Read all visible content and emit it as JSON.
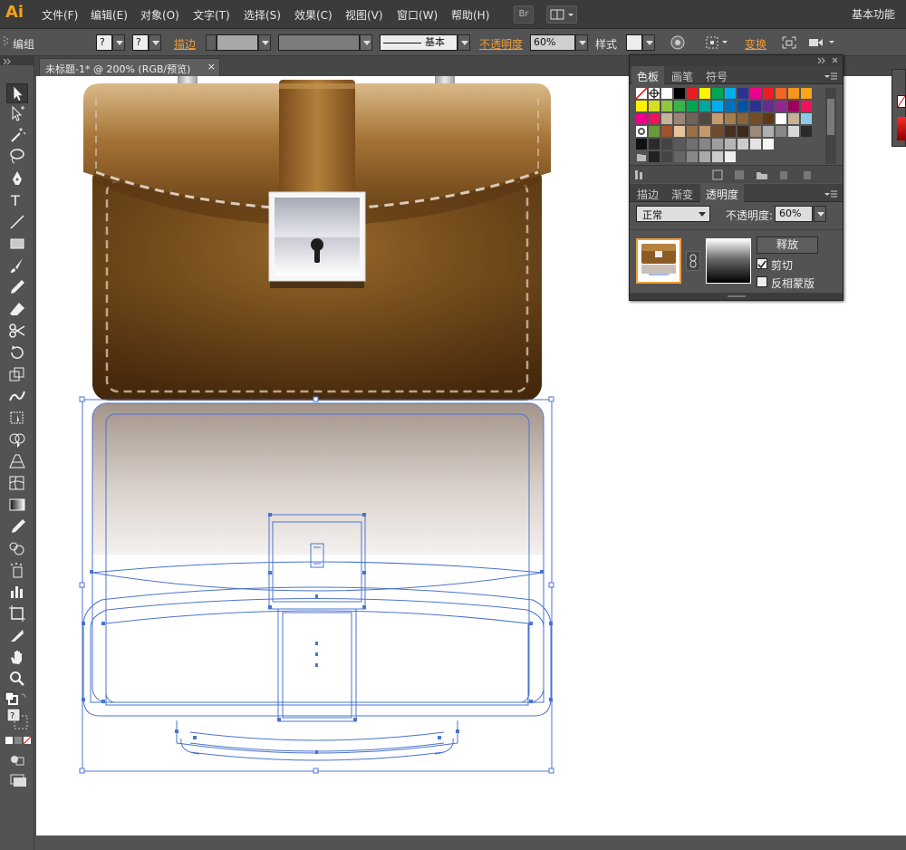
{
  "app": {
    "logo": "Ai",
    "workspace": "基本功能"
  },
  "menu": [
    "文件(F)",
    "编辑(E)",
    "对象(O)",
    "文字(T)",
    "选择(S)",
    "效果(C)",
    "视图(V)",
    "窗口(W)",
    "帮助(H)"
  ],
  "menubar_buttons": {
    "bridge": "Br"
  },
  "control": {
    "group_label": "编组",
    "stroke_label": "描边",
    "stroke_style": "基本",
    "opacity_label": "不透明度",
    "opacity_value": "60%",
    "style_label": "样式",
    "transform_label": "变换",
    "unknown_value": "?"
  },
  "document": {
    "tab_title": "未标题-1* @ 200% (RGB/预览)",
    "close_glyph": "×"
  },
  "swatch_panel": {
    "tabs": [
      "色板",
      "画笔",
      "符号"
    ],
    "active_tab": "色板"
  },
  "transparency_panel": {
    "tabs": [
      "描边",
      "渐变",
      "透明度"
    ],
    "active_tab": "透明度",
    "blend_mode": "正常",
    "opacity_label": "不透明度:",
    "opacity_value": "60%",
    "release_button": "释放",
    "clip_label": "剪切",
    "clip_checked": true,
    "invert_label": "反相蒙版",
    "invert_checked": false
  },
  "colors": {
    "accent": "#f29c38",
    "selection": "#4a74cf",
    "leather_light": "#b5823f",
    "leather_dark": "#4e2f10"
  },
  "icons": [
    "selection-tool-icon",
    "direct-selection-icon",
    "magic-wand-icon",
    "lasso-icon",
    "pen-icon",
    "type-icon",
    "line-icon",
    "rectangle-icon",
    "paintbrush-icon",
    "pencil-icon",
    "eraser-icon",
    "scissors-icon",
    "rotate-icon",
    "scale-icon",
    "warp-icon",
    "free-transform-icon",
    "shape-builder-icon",
    "perspective-icon",
    "mesh-icon",
    "gradient-icon",
    "eyedropper-icon",
    "blend-icon",
    "symbol-sprayer-icon",
    "graph-icon",
    "artboard-icon",
    "slice-icon",
    "hand-icon",
    "zoom-icon"
  ]
}
